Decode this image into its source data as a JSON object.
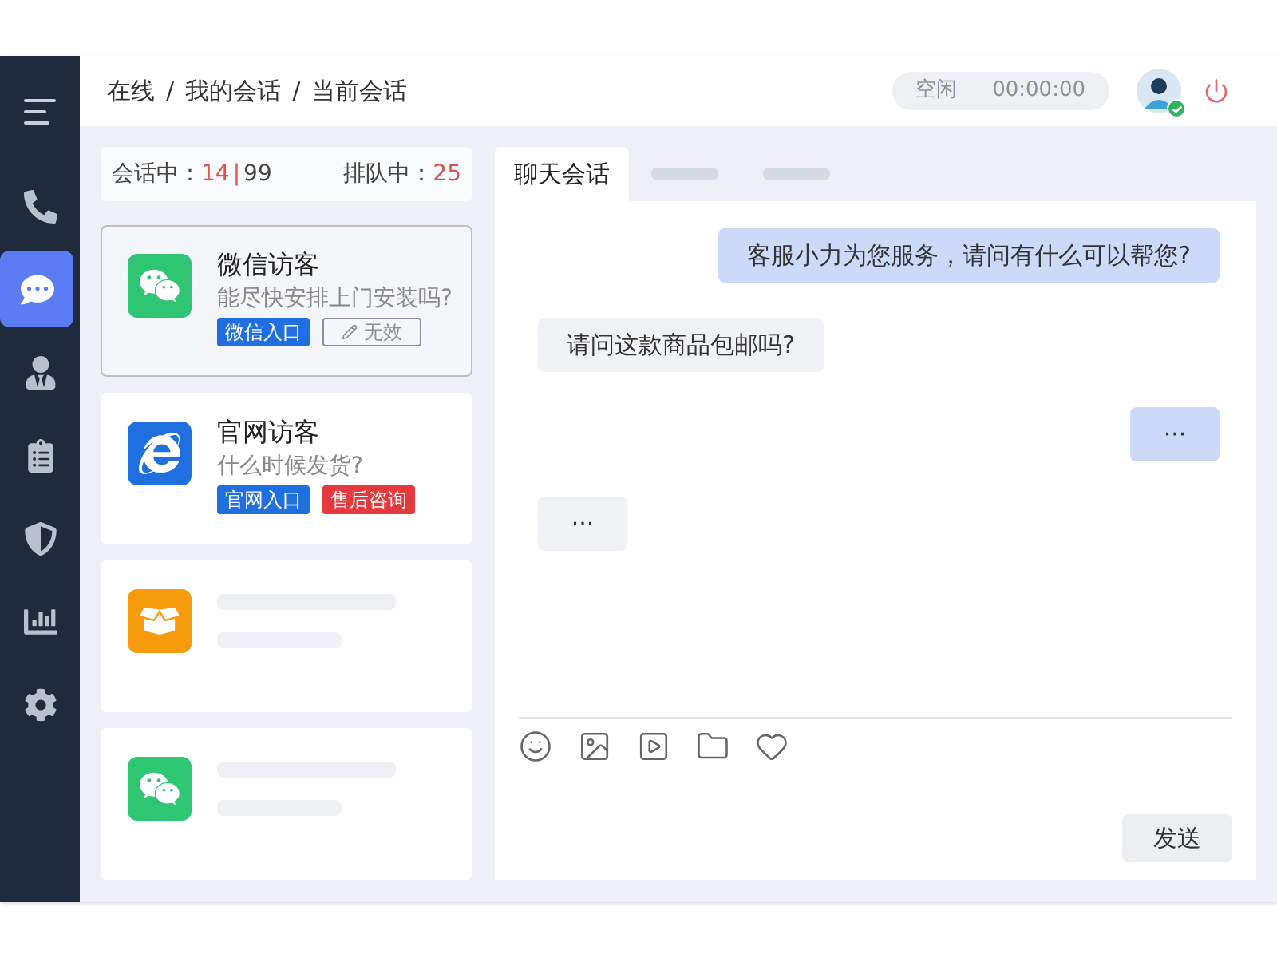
{
  "sidebar": {
    "items": [
      {
        "selected": false
      },
      {
        "selected": true
      },
      {
        "selected": false
      },
      {
        "selected": false
      },
      {
        "selected": false
      },
      {
        "selected": false
      },
      {
        "selected": false
      }
    ]
  },
  "breadcrumb": {
    "items": [
      "在线",
      "我的会话",
      "当前会话"
    ],
    "separators": [
      "/",
      "/"
    ]
  },
  "status": {
    "state": "空闲",
    "timer": "00:00:00"
  },
  "user": {
    "online": true
  },
  "stats": {
    "active_label": "会话中：",
    "active": "14",
    "divider": "|",
    "capacity": "99",
    "queue_label": "排队中：",
    "queue": "25"
  },
  "conversations": [
    {
      "kind": "wechat",
      "selected": true,
      "name": "微信访客",
      "message": "能尽快安排上门安装吗?",
      "tags": [
        {
          "kind": "solid",
          "label": "微信入口",
          "color": "#1f6fe0"
        },
        {
          "kind": "outline",
          "label": "无效",
          "color": "#8a8f99"
        }
      ]
    },
    {
      "kind": "web",
      "selected": false,
      "name": "官网访客",
      "message": "什么时候发货?",
      "tags": [
        {
          "kind": "solid",
          "label": "官网入口",
          "color": "#1f6fe0"
        },
        {
          "kind": "solid",
          "label": "售后咨询",
          "color": "#e5393d"
        }
      ]
    },
    {
      "kind": "box",
      "selected": false
    },
    {
      "kind": "wechat",
      "selected": false
    }
  ],
  "tabs": [
    {
      "kind": "text",
      "label": "聊天会话",
      "selected": true
    },
    {
      "kind": "placeholder",
      "selected": false
    },
    {
      "kind": "placeholder",
      "selected": false
    }
  ],
  "messages": [
    {
      "kind": "outgoing",
      "text": "客服小力为您服务，请问有什么可以帮您?"
    },
    {
      "kind": "incoming",
      "text": "请问这款商品包邮吗?"
    },
    {
      "kind": "outgoing",
      "text": "···"
    },
    {
      "kind": "incoming",
      "text": "···"
    }
  ],
  "send_button": "发送"
}
